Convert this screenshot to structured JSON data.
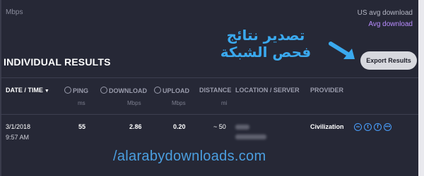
{
  "top": {
    "unit": "Mbps",
    "us_avg_label": "US avg download",
    "avg_link": "Avg download"
  },
  "overlay": {
    "arabic_caption": "تصدير نتائج فحص الشبكة"
  },
  "section": {
    "title": "INDIVIDUAL RESULTS",
    "export_label": "Export Results"
  },
  "columns": [
    {
      "label": "DATE / TIME",
      "sub": ""
    },
    {
      "label": "PING",
      "sub": "ms"
    },
    {
      "label": "DOWNLOAD",
      "sub": "Mbps"
    },
    {
      "label": "UPLOAD",
      "sub": "Mbps"
    },
    {
      "label": "DISTANCE",
      "sub": "mi"
    },
    {
      "label": "LOCATION / SERVER",
      "sub": ""
    },
    {
      "label": "PROVIDER",
      "sub": ""
    }
  ],
  "sort_indicator": "▼",
  "rows": [
    {
      "date": "3/1/2018",
      "time": "9:57 AM",
      "ping": "55",
      "download": "2.86",
      "upload": "0.20",
      "distance": "~ 50",
      "provider": "Civilization",
      "share_icons": [
        "link-icon",
        "twitter-icon",
        "facebook-icon",
        "more-icon"
      ]
    }
  ],
  "watermark": "/alarabydownloads.com",
  "colors": {
    "accent_purple": "#b98cff",
    "accent_blue": "#3aa9ee",
    "background": "#262836"
  }
}
